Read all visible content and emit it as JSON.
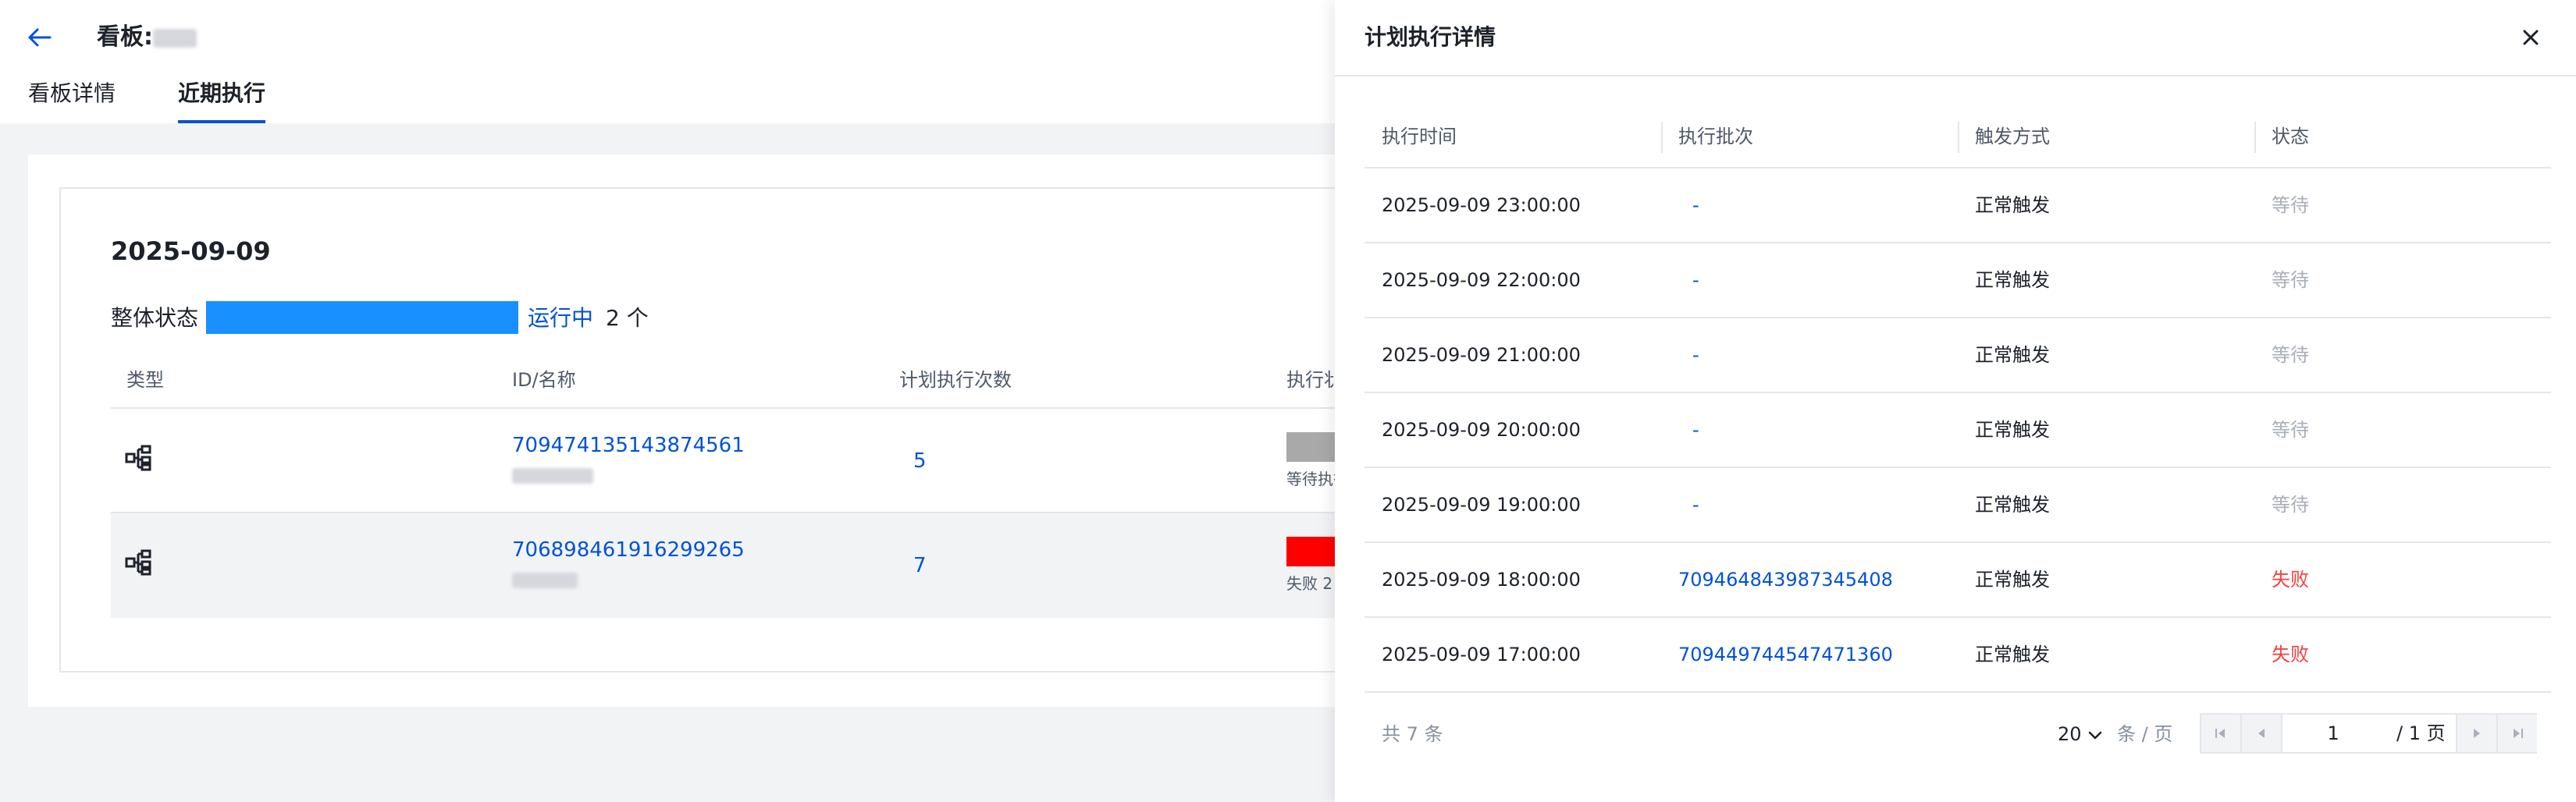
{
  "header": {
    "title_prefix": "看板:",
    "tabs": [
      {
        "label": "看板详情",
        "active": false
      },
      {
        "label": "近期执行",
        "active": true
      }
    ]
  },
  "summary": {
    "date": "2025-09-09",
    "status_label": "整体状态",
    "status_value": "运行中",
    "status_count": "2 个",
    "status_color": "#1890ff"
  },
  "left_table": {
    "columns": [
      "类型",
      "ID/名称",
      "计划执行次数",
      "执行状态"
    ],
    "rows": [
      {
        "icon": "workflow-icon",
        "id": "709474135143874561",
        "count": "5",
        "status_color": "#a9a9a9",
        "status_text": "等待执行"
      },
      {
        "icon": "workflow-icon",
        "id": "706898461916299265",
        "count": "7",
        "status_color": "#ff0000",
        "status_text": "失败 2"
      }
    ]
  },
  "drawer": {
    "title": "计划执行详情",
    "columns": [
      "执行时间",
      "执行批次",
      "触发方式",
      "状态"
    ],
    "rows": [
      {
        "time": "2025-09-09 23:00:00",
        "batch": "-",
        "trigger": "正常触发",
        "status": "等待",
        "status_type": "wait"
      },
      {
        "time": "2025-09-09 22:00:00",
        "batch": "-",
        "trigger": "正常触发",
        "status": "等待",
        "status_type": "wait"
      },
      {
        "time": "2025-09-09 21:00:00",
        "batch": "-",
        "trigger": "正常触发",
        "status": "等待",
        "status_type": "wait"
      },
      {
        "time": "2025-09-09 20:00:00",
        "batch": "-",
        "trigger": "正常触发",
        "status": "等待",
        "status_type": "wait"
      },
      {
        "time": "2025-09-09 19:00:00",
        "batch": "-",
        "trigger": "正常触发",
        "status": "等待",
        "status_type": "wait"
      },
      {
        "time": "2025-09-09 18:00:00",
        "batch": "709464843987345408",
        "trigger": "正常触发",
        "status": "失败",
        "status_type": "fail"
      },
      {
        "time": "2025-09-09 17:00:00",
        "batch": "709449744547471360",
        "trigger": "正常触发",
        "status": "失败",
        "status_type": "fail"
      }
    ],
    "pagination": {
      "total_text": "共 7 条",
      "page_size": "20",
      "page_size_unit": "条 / 页",
      "current_page": "1",
      "total_pages_text": "/ 1 页"
    }
  },
  "colors": {
    "link": "#0052d9",
    "fail": "#f53f3f",
    "wait": "#a9aeb8"
  }
}
